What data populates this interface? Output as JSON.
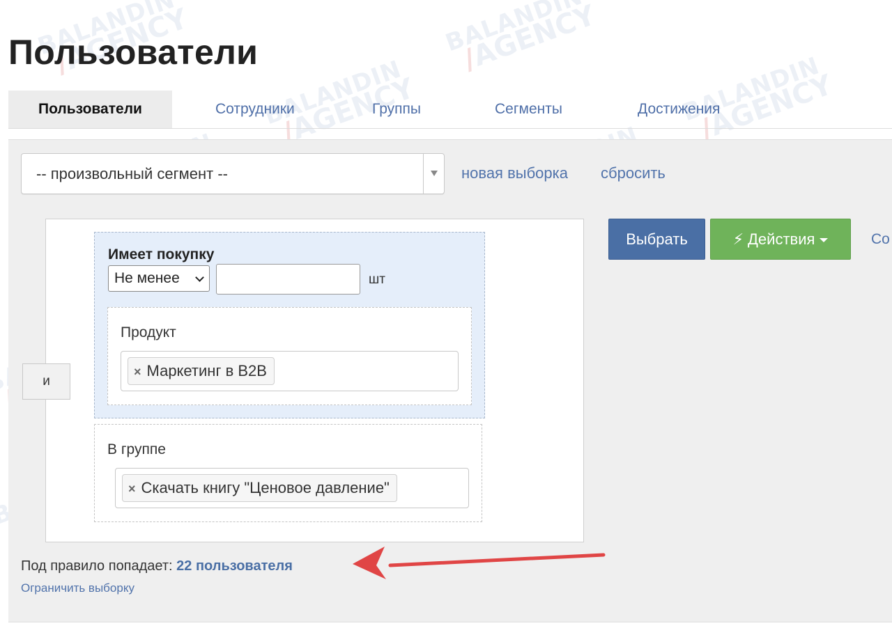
{
  "page": {
    "title": "Пользователи"
  },
  "tabs": [
    {
      "label": "Пользователи",
      "active": true
    },
    {
      "label": "Сотрудники",
      "active": false
    },
    {
      "label": "Группы",
      "active": false
    },
    {
      "label": "Сегменты",
      "active": false
    },
    {
      "label": "Достижения",
      "active": false
    }
  ],
  "filter": {
    "segment_value": "-- произвольный сегмент --",
    "new_selection_link": "новая выборка",
    "reset_link": "сбросить"
  },
  "rule": {
    "and_label": "и",
    "purchase": {
      "title": "Имеет покупку",
      "comparison_value": "Не менее",
      "quantity_value": "",
      "unit": "шт",
      "product_label": "Продукт",
      "product_tags": [
        "Маркетинг в B2B"
      ]
    },
    "group": {
      "label": "В группе",
      "group_tags": [
        "Скачать книгу \"Ценовое давление\""
      ]
    }
  },
  "actions": {
    "select_button": "Выбрать",
    "actions_button": "Действия",
    "save_button_visible": "Со",
    "actions_color": "#6fb35a",
    "select_color": "#4a6fa5"
  },
  "result": {
    "prefix": "Под правило попадает:",
    "count_text": "22 пользователя",
    "limit_link": "Ограничить выборку"
  },
  "annotation": {
    "arrow_color": "#e04545"
  },
  "watermark": {
    "line1": "BALANDIN",
    "line2": "AGENCY"
  }
}
